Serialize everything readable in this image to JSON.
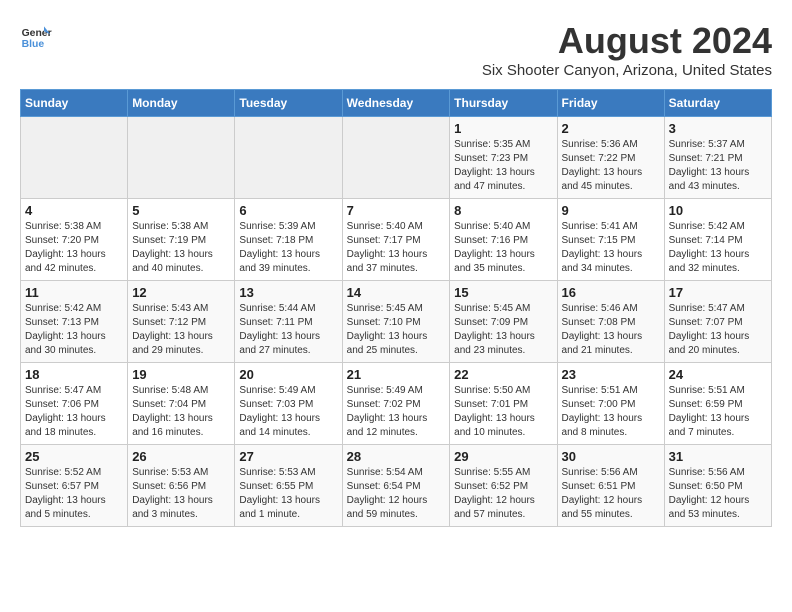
{
  "header": {
    "logo_line1": "General",
    "logo_line2": "Blue",
    "month_year": "August 2024",
    "location": "Six Shooter Canyon, Arizona, United States"
  },
  "weekdays": [
    "Sunday",
    "Monday",
    "Tuesday",
    "Wednesday",
    "Thursday",
    "Friday",
    "Saturday"
  ],
  "weeks": [
    [
      {
        "day": "",
        "info": ""
      },
      {
        "day": "",
        "info": ""
      },
      {
        "day": "",
        "info": ""
      },
      {
        "day": "",
        "info": ""
      },
      {
        "day": "1",
        "info": "Sunrise: 5:35 AM\nSunset: 7:23 PM\nDaylight: 13 hours\nand 47 minutes."
      },
      {
        "day": "2",
        "info": "Sunrise: 5:36 AM\nSunset: 7:22 PM\nDaylight: 13 hours\nand 45 minutes."
      },
      {
        "day": "3",
        "info": "Sunrise: 5:37 AM\nSunset: 7:21 PM\nDaylight: 13 hours\nand 43 minutes."
      }
    ],
    [
      {
        "day": "4",
        "info": "Sunrise: 5:38 AM\nSunset: 7:20 PM\nDaylight: 13 hours\nand 42 minutes."
      },
      {
        "day": "5",
        "info": "Sunrise: 5:38 AM\nSunset: 7:19 PM\nDaylight: 13 hours\nand 40 minutes."
      },
      {
        "day": "6",
        "info": "Sunrise: 5:39 AM\nSunset: 7:18 PM\nDaylight: 13 hours\nand 39 minutes."
      },
      {
        "day": "7",
        "info": "Sunrise: 5:40 AM\nSunset: 7:17 PM\nDaylight: 13 hours\nand 37 minutes."
      },
      {
        "day": "8",
        "info": "Sunrise: 5:40 AM\nSunset: 7:16 PM\nDaylight: 13 hours\nand 35 minutes."
      },
      {
        "day": "9",
        "info": "Sunrise: 5:41 AM\nSunset: 7:15 PM\nDaylight: 13 hours\nand 34 minutes."
      },
      {
        "day": "10",
        "info": "Sunrise: 5:42 AM\nSunset: 7:14 PM\nDaylight: 13 hours\nand 32 minutes."
      }
    ],
    [
      {
        "day": "11",
        "info": "Sunrise: 5:42 AM\nSunset: 7:13 PM\nDaylight: 13 hours\nand 30 minutes."
      },
      {
        "day": "12",
        "info": "Sunrise: 5:43 AM\nSunset: 7:12 PM\nDaylight: 13 hours\nand 29 minutes."
      },
      {
        "day": "13",
        "info": "Sunrise: 5:44 AM\nSunset: 7:11 PM\nDaylight: 13 hours\nand 27 minutes."
      },
      {
        "day": "14",
        "info": "Sunrise: 5:45 AM\nSunset: 7:10 PM\nDaylight: 13 hours\nand 25 minutes."
      },
      {
        "day": "15",
        "info": "Sunrise: 5:45 AM\nSunset: 7:09 PM\nDaylight: 13 hours\nand 23 minutes."
      },
      {
        "day": "16",
        "info": "Sunrise: 5:46 AM\nSunset: 7:08 PM\nDaylight: 13 hours\nand 21 minutes."
      },
      {
        "day": "17",
        "info": "Sunrise: 5:47 AM\nSunset: 7:07 PM\nDaylight: 13 hours\nand 20 minutes."
      }
    ],
    [
      {
        "day": "18",
        "info": "Sunrise: 5:47 AM\nSunset: 7:06 PM\nDaylight: 13 hours\nand 18 minutes."
      },
      {
        "day": "19",
        "info": "Sunrise: 5:48 AM\nSunset: 7:04 PM\nDaylight: 13 hours\nand 16 minutes."
      },
      {
        "day": "20",
        "info": "Sunrise: 5:49 AM\nSunset: 7:03 PM\nDaylight: 13 hours\nand 14 minutes."
      },
      {
        "day": "21",
        "info": "Sunrise: 5:49 AM\nSunset: 7:02 PM\nDaylight: 13 hours\nand 12 minutes."
      },
      {
        "day": "22",
        "info": "Sunrise: 5:50 AM\nSunset: 7:01 PM\nDaylight: 13 hours\nand 10 minutes."
      },
      {
        "day": "23",
        "info": "Sunrise: 5:51 AM\nSunset: 7:00 PM\nDaylight: 13 hours\nand 8 minutes."
      },
      {
        "day": "24",
        "info": "Sunrise: 5:51 AM\nSunset: 6:59 PM\nDaylight: 13 hours\nand 7 minutes."
      }
    ],
    [
      {
        "day": "25",
        "info": "Sunrise: 5:52 AM\nSunset: 6:57 PM\nDaylight: 13 hours\nand 5 minutes."
      },
      {
        "day": "26",
        "info": "Sunrise: 5:53 AM\nSunset: 6:56 PM\nDaylight: 13 hours\nand 3 minutes."
      },
      {
        "day": "27",
        "info": "Sunrise: 5:53 AM\nSunset: 6:55 PM\nDaylight: 13 hours\nand 1 minute."
      },
      {
        "day": "28",
        "info": "Sunrise: 5:54 AM\nSunset: 6:54 PM\nDaylight: 12 hours\nand 59 minutes."
      },
      {
        "day": "29",
        "info": "Sunrise: 5:55 AM\nSunset: 6:52 PM\nDaylight: 12 hours\nand 57 minutes."
      },
      {
        "day": "30",
        "info": "Sunrise: 5:56 AM\nSunset: 6:51 PM\nDaylight: 12 hours\nand 55 minutes."
      },
      {
        "day": "31",
        "info": "Sunrise: 5:56 AM\nSunset: 6:50 PM\nDaylight: 12 hours\nand 53 minutes."
      }
    ]
  ]
}
